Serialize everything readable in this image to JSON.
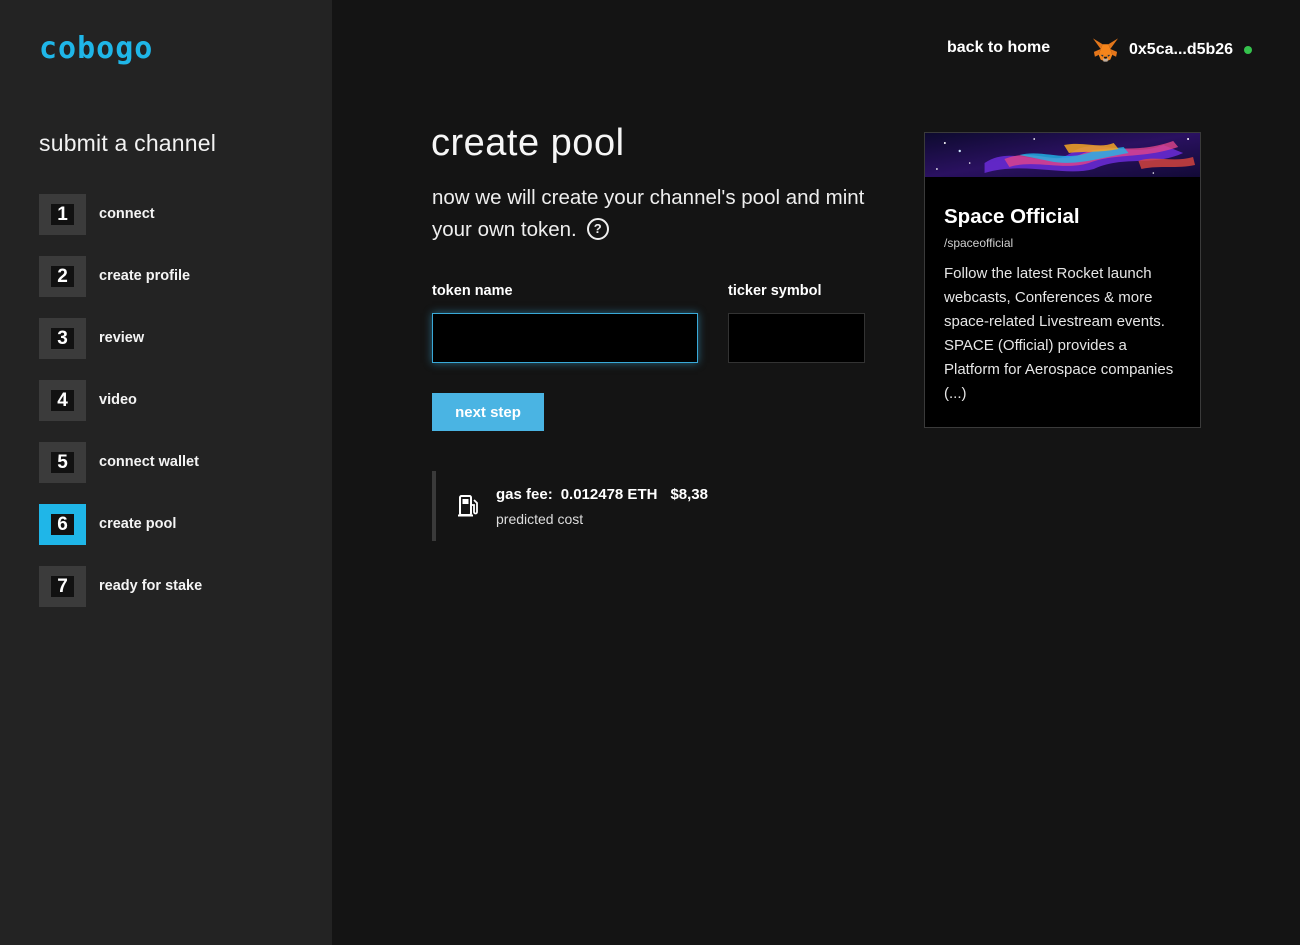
{
  "brand": {
    "logo_text": "cobogo",
    "accent_color": "#1fb6e8"
  },
  "sidebar": {
    "title": "submit a channel",
    "steps": [
      {
        "number": "1",
        "label": "connect",
        "active": false
      },
      {
        "number": "2",
        "label": "create profile",
        "active": false
      },
      {
        "number": "3",
        "label": "review",
        "active": false
      },
      {
        "number": "4",
        "label": "video",
        "active": false
      },
      {
        "number": "5",
        "label": "connect wallet",
        "active": false
      },
      {
        "number": "6",
        "label": "create pool",
        "active": true
      },
      {
        "number": "7",
        "label": "ready for stake",
        "active": false
      }
    ]
  },
  "header": {
    "back_link": "back to home",
    "wallet_icon": "metamask-fox-icon",
    "wallet_address": "0x5ca...d5b26",
    "wallet_status_color": "#35c24d"
  },
  "main": {
    "title": "create pool",
    "description": "now we will create your channel's pool and mint your own token.",
    "help_glyph": "?",
    "token_name": {
      "label": "token name",
      "value": ""
    },
    "ticker_symbol": {
      "label": "ticker symbol",
      "value": ""
    },
    "next_button": "next step",
    "gas": {
      "icon": "gas-pump-icon",
      "label": "gas fee:",
      "eth": "0.012478 ETH",
      "usd": "$8,38",
      "note": "predicted cost"
    }
  },
  "channel_card": {
    "title": "Space Official",
    "handle": "/spaceofficial",
    "description": "Follow the latest Rocket launch webcasts, Conferences & more space-related Livestream events. SPACE (Official) provides a Platform for Aerospace companies (...)"
  }
}
